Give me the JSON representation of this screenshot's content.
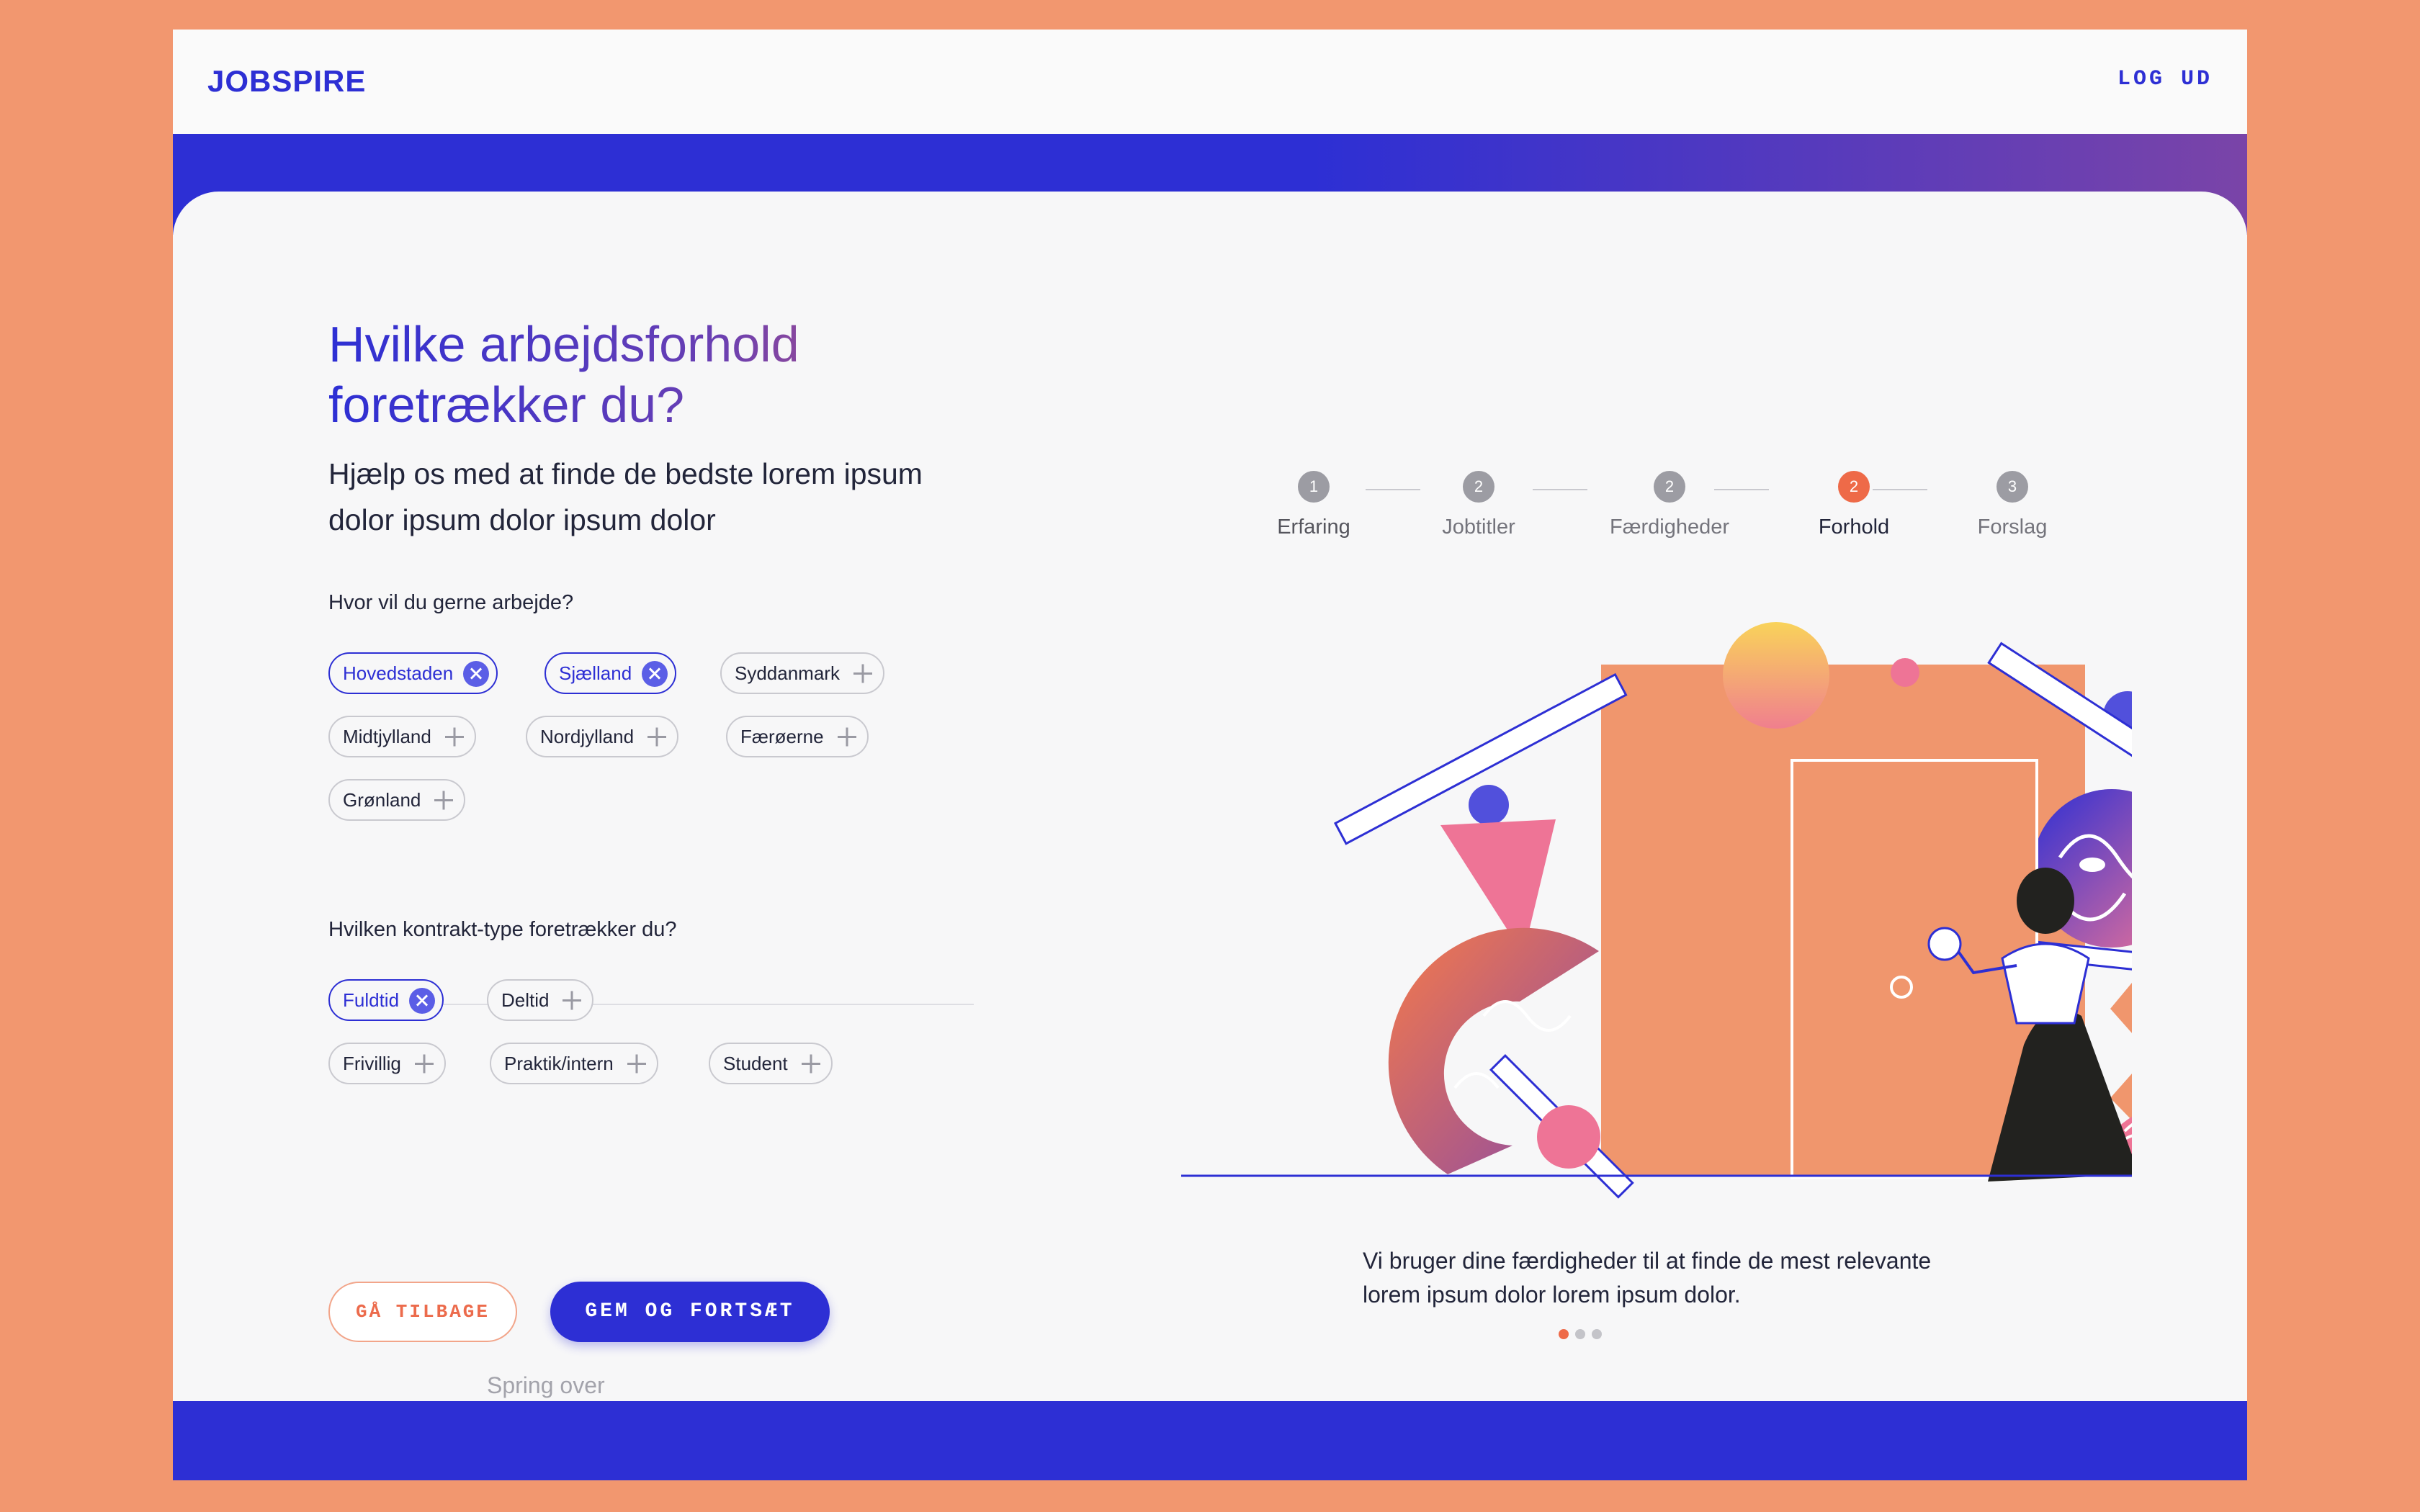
{
  "header": {
    "logo": "JOBSPIRE",
    "logout": "LOG UD"
  },
  "main": {
    "title": "Hvilke arbejdsforhold foretrækker du?",
    "subtitle": "Hjælp os med at finde de bedste lorem ipsum dolor ipsum dolor ipsum dolor",
    "location_question": "Hvor vil du gerne arbejde?",
    "locations": [
      {
        "label": "Hovedstaden",
        "selected": true
      },
      {
        "label": "Sjælland",
        "selected": true
      },
      {
        "label": "Syddanmark",
        "selected": false
      },
      {
        "label": "Midtjylland",
        "selected": false
      },
      {
        "label": "Nordjylland",
        "selected": false
      },
      {
        "label": "Færøerne",
        "selected": false
      },
      {
        "label": "Grønland",
        "selected": false
      }
    ],
    "contract_question": "Hvilken kontrakt-type foretrækker du?",
    "contracts": [
      {
        "label": "Fuldtid",
        "selected": true
      },
      {
        "label": "Deltid",
        "selected": false
      },
      {
        "label": "Frivillig",
        "selected": false
      },
      {
        "label": "Praktik/intern",
        "selected": false
      },
      {
        "label": "Student",
        "selected": false
      }
    ],
    "back_button": "GÅ TILBAGE",
    "save_button": "GEM OG FORTSÆT",
    "skip_link": "Spring over"
  },
  "progress": {
    "steps": [
      {
        "number": "1",
        "label": "Erfaring",
        "state": "done"
      },
      {
        "number": "2",
        "label": "Jobtitler",
        "state": "todo"
      },
      {
        "number": "2",
        "label": "Færdigheder",
        "state": "todo"
      },
      {
        "number": "2",
        "label": "Forhold",
        "state": "active"
      },
      {
        "number": "3",
        "label": "Forslag",
        "state": "todo"
      }
    ]
  },
  "illustration": {
    "caption": "Vi bruger dine færdigheder til at finde de mest relevante lorem ipsum dolor lorem ipsum dolor.",
    "carousel_total": 3,
    "carousel_active": 1
  },
  "colors": {
    "primary": "#2d2fd4",
    "accent": "#ee6a48",
    "background": "#f2976f",
    "pink": "#ee7496",
    "door": "#f0966d"
  }
}
